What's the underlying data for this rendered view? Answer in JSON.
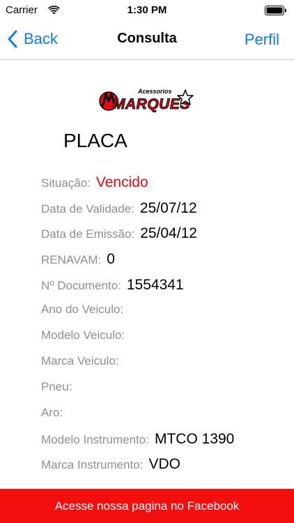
{
  "status_bar": {
    "carrier": "Carrier",
    "time": "1:30 PM",
    "icons": [
      "wifi-icon",
      "battery-icon"
    ]
  },
  "nav": {
    "back_label": "Back",
    "title": "Consulta",
    "right_label": "Perfil",
    "accent_color": "#0a7aff"
  },
  "logo": {
    "top_text": "Acessorios",
    "brand_text": "MARQUES",
    "colors": {
      "primary": "#e50914",
      "outline": "#000000"
    }
  },
  "placa": "PLACA",
  "fields": [
    {
      "label": "Situação:",
      "value": "Vencido",
      "value_color": "#e50914"
    },
    {
      "label": "Data de Validade:",
      "value": "25/07/12"
    },
    {
      "label": "Data de Emissão:",
      "value": "25/04/12"
    },
    {
      "label": "RENAVAM:",
      "value": "0"
    },
    {
      "label": "Nº Documento:",
      "value": "1554341"
    },
    {
      "label": "Ano do Veiculo:",
      "value": ""
    },
    {
      "label": "Modelo Veiculo:",
      "value": ""
    },
    {
      "label": "Marca Veiculo:",
      "value": ""
    },
    {
      "label": "Pneu:",
      "value": ""
    },
    {
      "label": "Aro:",
      "value": ""
    },
    {
      "label": "Modelo Instrumento:",
      "value": "MTCO 1390"
    },
    {
      "label": "Marca Instrumento:",
      "value": "VDO"
    }
  ],
  "footer": {
    "label": "Acesse nossa pagina no Facebook",
    "color": "#f40f0f"
  }
}
